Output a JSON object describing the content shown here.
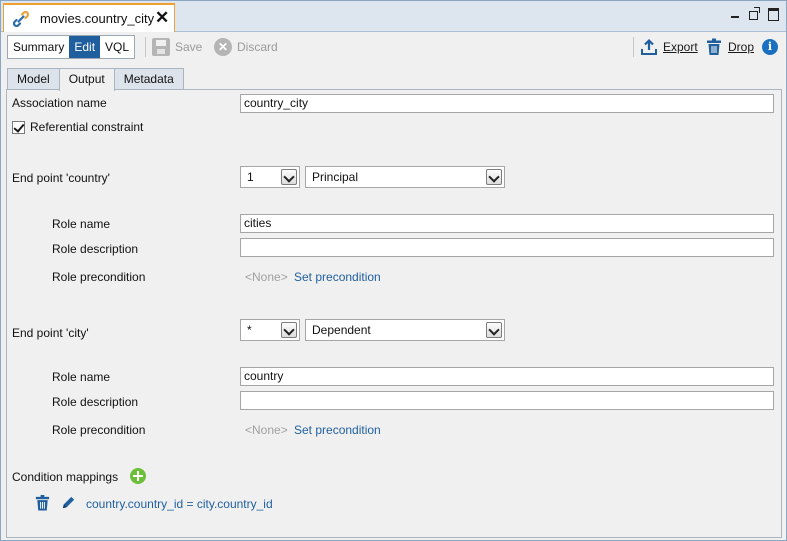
{
  "window": {
    "tab_title": "movies.country_city",
    "tab_icon": "chain-link-icon"
  },
  "toolbar": {
    "modes": [
      "Summary",
      "Edit",
      "VQL"
    ],
    "active_mode": "Edit",
    "save_label": "Save",
    "discard_label": "Discard",
    "export_label": "Export",
    "drop_label": "Drop"
  },
  "subtabs": {
    "items": [
      "Model",
      "Output",
      "Metadata"
    ],
    "active": "Output"
  },
  "form": {
    "association_name_label": "Association name",
    "association_name_value": "country_city",
    "referential_constraint_label": "Referential constraint",
    "referential_constraint_checked": true,
    "endpoints": [
      {
        "label": "End point 'country'",
        "multiplicity": "1",
        "role_type": "Principal",
        "role_name_label": "Role name",
        "role_name_value": "cities",
        "role_description_label": "Role description",
        "role_description_value": "",
        "role_precondition_label": "Role precondition",
        "precondition_value": "<None>",
        "set_precondition_link": "Set precondition"
      },
      {
        "label": "End point 'city'",
        "multiplicity": "*",
        "role_type": "Dependent",
        "role_name_label": "Role name",
        "role_name_value": "country",
        "role_description_label": "Role description",
        "role_description_value": "",
        "role_precondition_label": "Role precondition",
        "precondition_value": "<None>",
        "set_precondition_link": "Set precondition"
      }
    ],
    "condition_mappings_label": "Condition mappings",
    "mappings": [
      "country.country_id = city.country_id"
    ]
  },
  "colors": {
    "accent": "#1f5f9e",
    "tab_highlight": "#f0a030",
    "add_green": "#6cbf3a",
    "info_blue": "#1a6fc0"
  }
}
